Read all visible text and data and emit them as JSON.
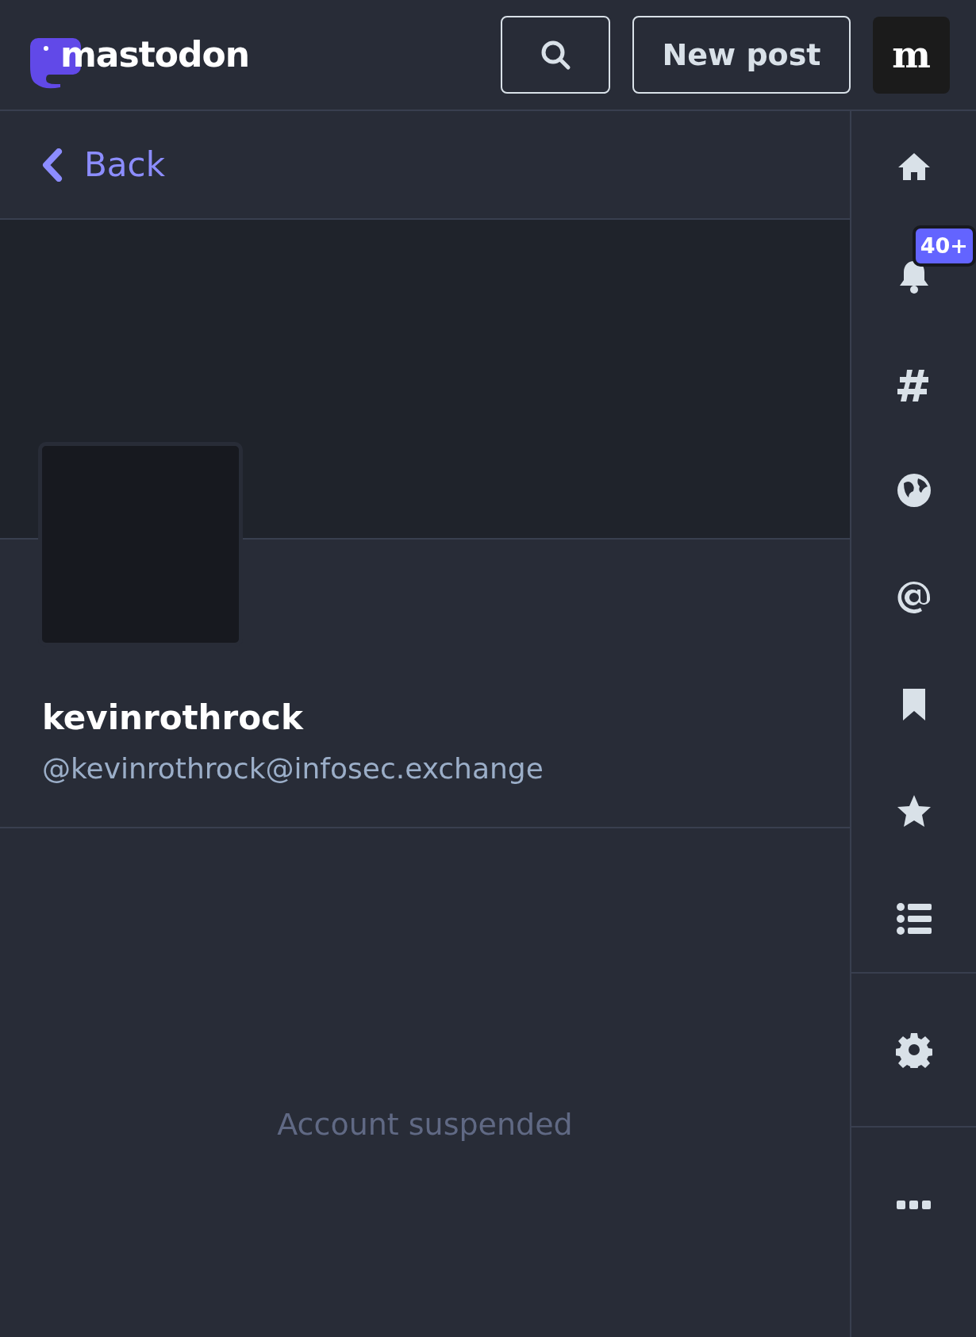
{
  "header": {
    "logo_text": "mastodon",
    "new_post": "New post",
    "account_button": "m"
  },
  "back": "Back",
  "profile": {
    "display_name": "kevinrothrock",
    "handle": "@kevinrothrock@infosec.exchange"
  },
  "message": "Account suspended",
  "sidebar": {
    "items": [
      {
        "kind": "home"
      },
      {
        "kind": "notifications",
        "badge": "40+"
      },
      {
        "kind": "hashtag"
      },
      {
        "kind": "globe"
      },
      {
        "kind": "mention"
      },
      {
        "kind": "bookmark"
      },
      {
        "kind": "star"
      },
      {
        "kind": "list"
      },
      {
        "kind": "settings"
      },
      {
        "kind": "more"
      }
    ]
  }
}
